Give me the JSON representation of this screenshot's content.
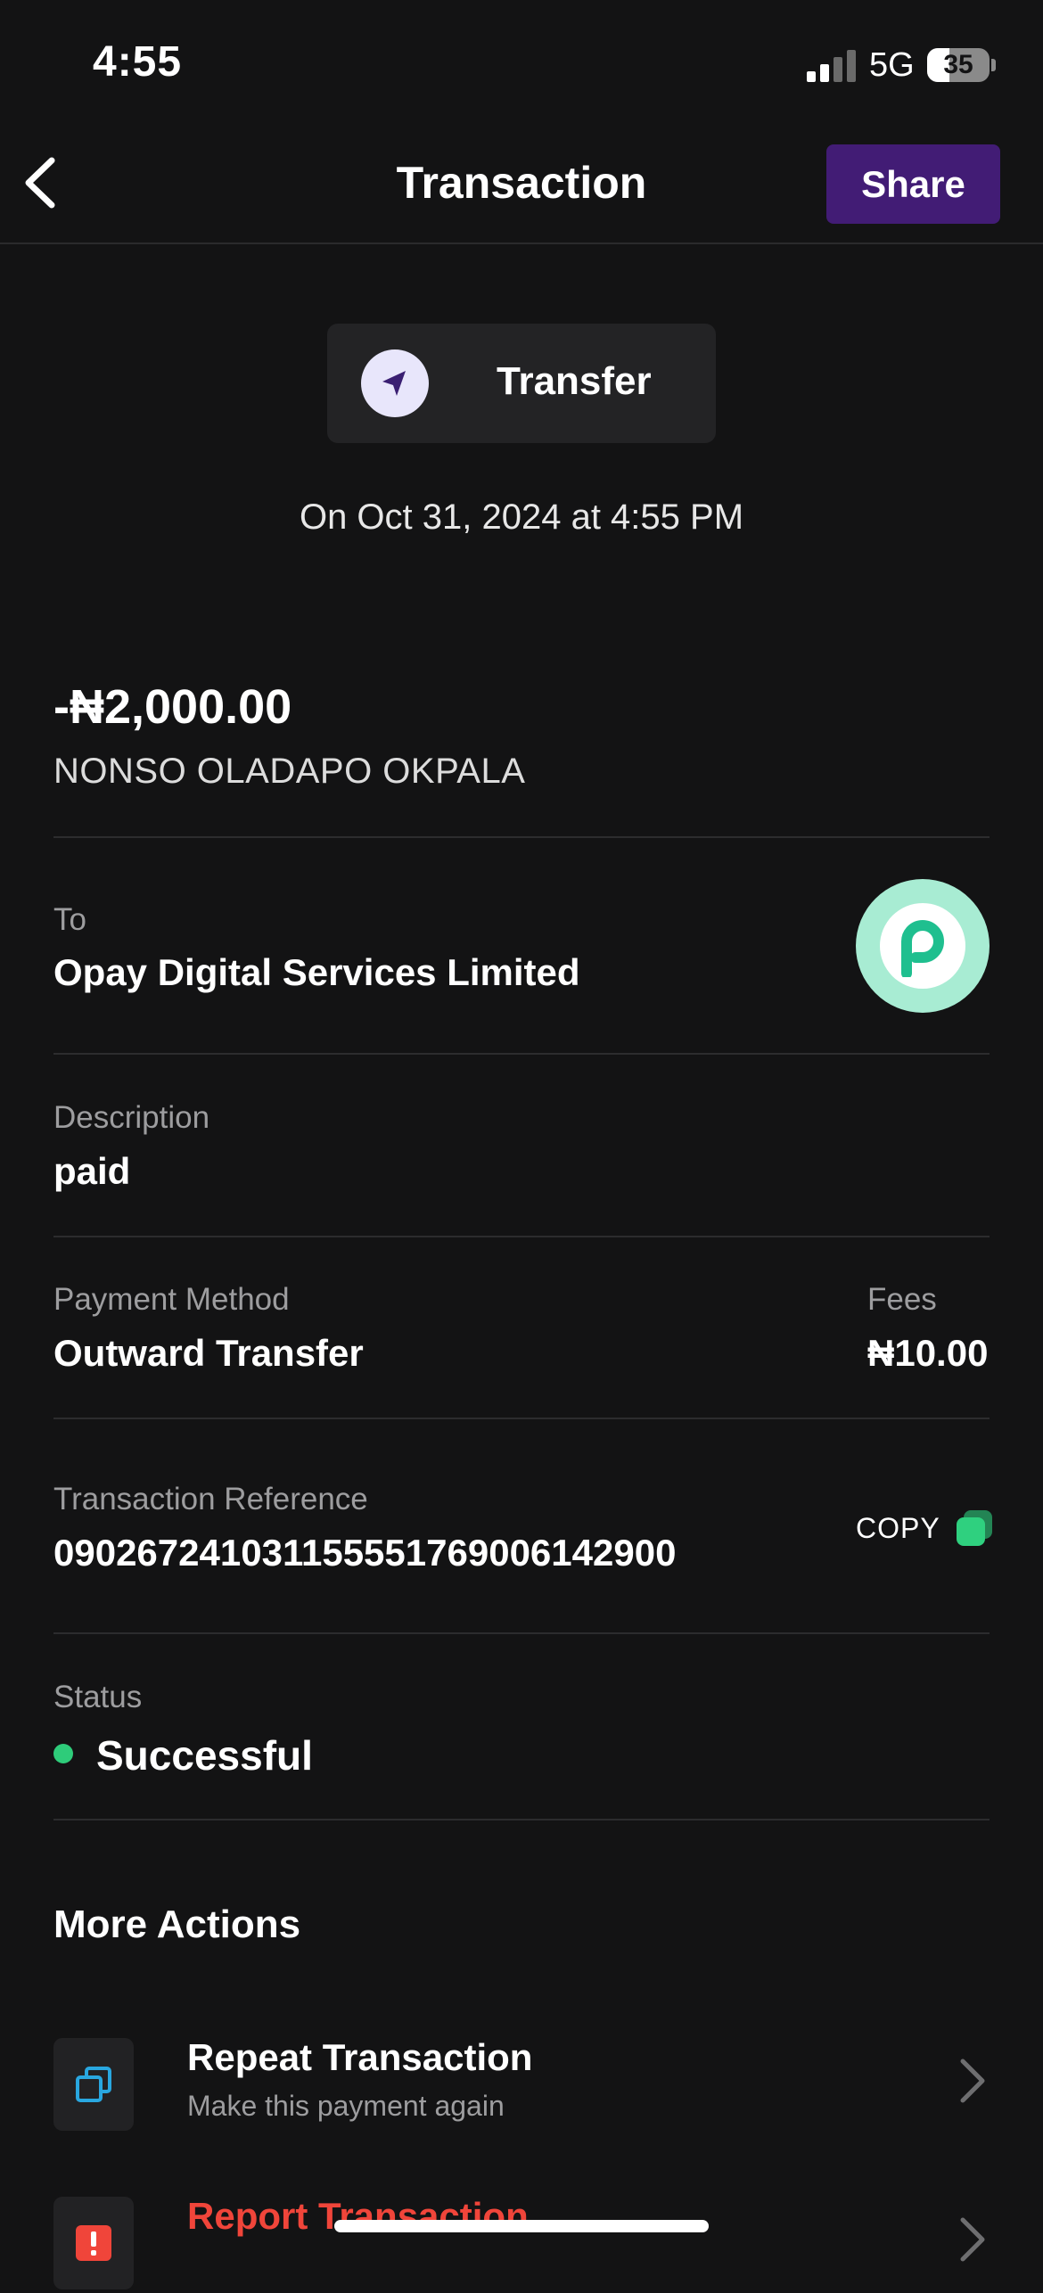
{
  "status_bar": {
    "time": "4:55",
    "network": "5G",
    "battery": "35",
    "battery_level": 0.35
  },
  "nav": {
    "title": "Transaction",
    "share_label": "Share"
  },
  "transaction": {
    "type": "Transfer",
    "date": "On Oct 31, 2024 at 4:55 PM",
    "amount": "-₦2,000.00",
    "sender_name": "NONSO OLADAPO OKPALA",
    "to_label": "To",
    "to_value": "Opay Digital Services Limited",
    "description_label": "Description",
    "description_value": "paid",
    "payment_method_label": "Payment Method",
    "payment_method_value": "Outward Transfer",
    "fees_label": "Fees",
    "fees_value": "₦10.00",
    "reference_label": "Transaction Reference",
    "reference_value": "090267241031155551769006142900",
    "copy_label": "COPY",
    "status_label": "Status",
    "status_value": "Successful"
  },
  "more_actions": {
    "title": "More Actions",
    "items": [
      {
        "title": "Repeat Transaction",
        "subtitle": "Make this payment again"
      },
      {
        "title": "Report Transaction",
        "subtitle": ""
      }
    ]
  },
  "colors": {
    "background": "#131314",
    "share_button": "#421c75",
    "status_success": "#2ecc7a",
    "report_red": "#f0453a",
    "opay_green": "#1fbf8f",
    "copy_green": "#2fd07f",
    "repeat_icon": "#29a7e0"
  },
  "icons": {
    "back": "chevron-left-icon",
    "transfer": "send-arrow-icon",
    "opay": "opay-logo",
    "copy": "copy-icon",
    "repeat": "repeat-icon",
    "report": "alert-icon",
    "chevron": "chevron-right-icon"
  }
}
